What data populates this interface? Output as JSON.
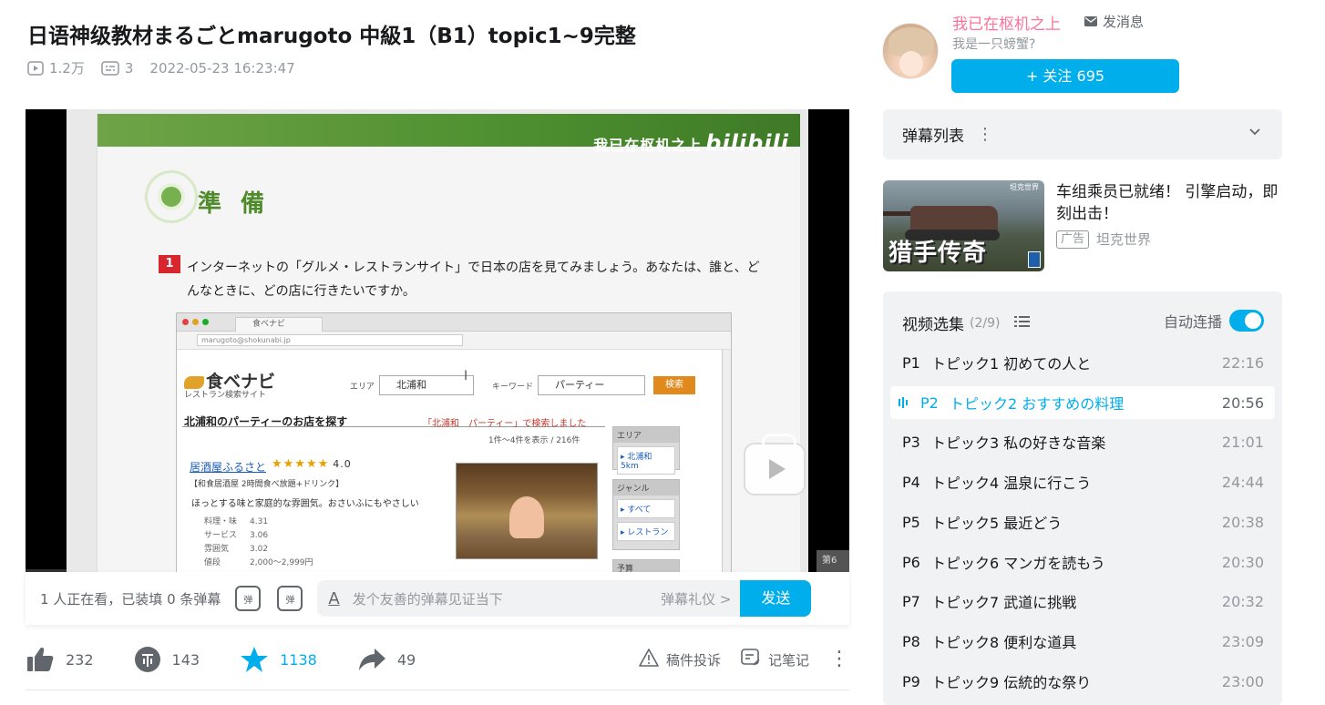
{
  "video": {
    "title": "日语神级教材まるごとmarugoto 中級1（B1）topic1~9完整",
    "views": "1.2万",
    "danmaku_count": "3",
    "date": "2022-05-23 16:23:47"
  },
  "player": {
    "watermark": "我已在枢机之上",
    "watermark_logo": "bilibili",
    "slide_heading": "準 備",
    "question_number": "1",
    "question_text": "インターネットの「グルメ・レストランサイト」で日本の店を見てみましょう。あなたは、誰と、どんなときに、どの店に行きたいですか。",
    "site_tab": "食ベナビ",
    "site_url": "marugoto@shokunabi.jp",
    "site_logo": "食ベナビ",
    "site_sub": "レストラン検索サイト",
    "area_label": "エリア",
    "area_value": "北浦和",
    "keyword_label": "キーワード",
    "keyword_value": "パーティー",
    "search_button": "検索",
    "result_title": "北浦和のパーティーのお店を探す",
    "result_note": "「北浦和　パーティー」で検索しました",
    "result_count": "1件～4件を表示 / 216件",
    "shop_name": "居酒屋ふるさと",
    "shop_stars": "★★★★★",
    "shop_score": "4.0",
    "shop_sub": "【和食居酒屋 2時間食べ放題+ドリンク】",
    "shop_desc": "ほっとする味と家庭的な雰囲気。おさいふにもやさしい",
    "ratings": [
      {
        "label": "料理・味",
        "value": "4.31"
      },
      {
        "label": "サービス",
        "value": "3.06"
      },
      {
        "label": "雰囲気",
        "value": "3.02"
      },
      {
        "label": "値段",
        "value": "2,000～2,999円"
      }
    ],
    "side_area_head": "エリア",
    "side_area_item": "▸ 北浦和 5km",
    "side_genre_head": "ジャンル",
    "side_genre_item1": "▸ すべて",
    "side_genre_item2": "▸ レストラン",
    "side_budget_head": "予算",
    "next_label": "第6"
  },
  "danmaku_bar": {
    "watchers": "1 人正在看，已装填 0 条弹幕",
    "input_placeholder": "发个友善的弹幕见证当下",
    "etiquette": "弹幕礼仪 >",
    "send": "发送",
    "dm_toggle_label": "弹",
    "dm_settings_label": "弹"
  },
  "actions": {
    "likes": "232",
    "coins": "143",
    "favorites": "1138",
    "shares": "49",
    "report": "稿件投诉",
    "notes": "记笔记"
  },
  "uploader": {
    "name": "我已在枢机之上",
    "message": "发消息",
    "signature": "我是一只螃蟹?",
    "follow": "+ 关注 695"
  },
  "danmaku_list": {
    "title": "弹幕列表"
  },
  "ad": {
    "caption": "猎手传奇",
    "brand_corner": "坦克世界",
    "title": "车组乘员已就绪！ 引擎启动，即刻出击！",
    "tag": "广告",
    "source": "坦克世界"
  },
  "playlist": {
    "title": "视频选集",
    "count": "(2/9)",
    "autoplay": "自动连播",
    "episodes": [
      {
        "num": "P1",
        "name": "トピック1 初めての人と",
        "dur": "22:16"
      },
      {
        "num": "P2",
        "name": "トピック2 おすすめの料理",
        "dur": "20:56"
      },
      {
        "num": "P3",
        "name": "トピック3 私の好きな音楽",
        "dur": "21:01"
      },
      {
        "num": "P4",
        "name": "トピック4 温泉に行こう",
        "dur": "24:44"
      },
      {
        "num": "P5",
        "name": "トピック5 最近どう",
        "dur": "20:38"
      },
      {
        "num": "P6",
        "name": "トピック6 マンガを読もう",
        "dur": "20:30"
      },
      {
        "num": "P7",
        "name": "トピック7 武道に挑戦",
        "dur": "20:32"
      },
      {
        "num": "P8",
        "name": "トピック8 便利な道具",
        "dur": "23:09"
      },
      {
        "num": "P9",
        "name": "トピック9 伝統的な祭り",
        "dur": "23:00"
      }
    ],
    "active_index": 1
  },
  "colors": {
    "accent": "#00aeec",
    "uploader_name": "#fb7299"
  }
}
